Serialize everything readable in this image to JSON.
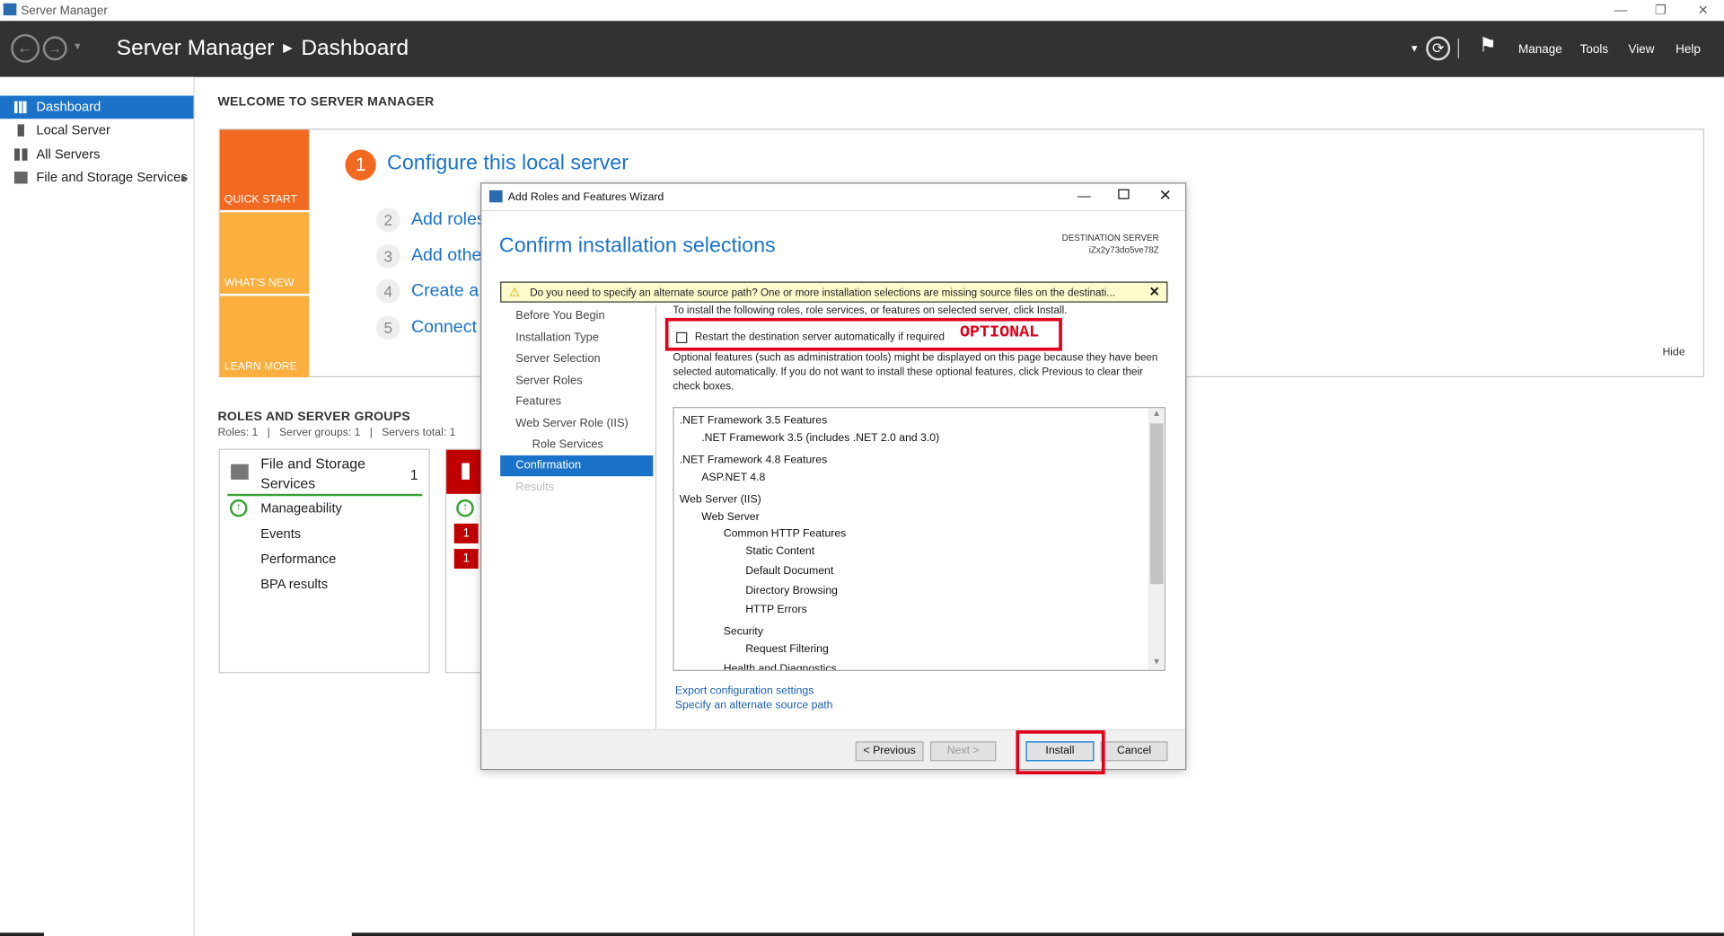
{
  "window": {
    "title": "Server Manager"
  },
  "header": {
    "app": "Server Manager",
    "page": "Dashboard",
    "menu": [
      "Manage",
      "Tools",
      "View",
      "Help"
    ]
  },
  "sidebar": {
    "items": [
      {
        "label": "Dashboard",
        "active": true
      },
      {
        "label": "Local Server"
      },
      {
        "label": "All Servers"
      },
      {
        "label": "File and Storage Services"
      }
    ]
  },
  "welcome": {
    "heading": "WELCOME TO SERVER MANAGER",
    "tiles": [
      "QUICK START",
      "WHAT'S NEW",
      "LEARN MORE"
    ],
    "steps": [
      {
        "n": "1",
        "label": "Configure this local server"
      },
      {
        "n": "2",
        "label": "Add roles"
      },
      {
        "n": "3",
        "label": "Add other"
      },
      {
        "n": "4",
        "label": "Create a s"
      },
      {
        "n": "5",
        "label": "Connect t"
      }
    ],
    "hide": "Hide"
  },
  "roles": {
    "heading": "ROLES AND SERVER GROUPS",
    "summary": "Roles: 1   |   Server groups: 1   |   Servers total: 1",
    "card": {
      "title_line1": "File and Storage",
      "title_line2": "Services",
      "count": "1",
      "rows": [
        "Manageability",
        "Events",
        "Performance",
        "BPA results"
      ]
    },
    "card2_badges": [
      "1",
      "1"
    ]
  },
  "wizard": {
    "title": "Add Roles and Features Wizard",
    "heading": "Confirm installation selections",
    "dest_label": "DESTINATION SERVER",
    "dest_value": "iZx2y73do5ve78Z",
    "warning": "Do you need to specify an alternate source path? One or more installation selections are missing source files on the destinati...",
    "nav": [
      "Before You Begin",
      "Installation Type",
      "Server Selection",
      "Server Roles",
      "Features",
      "Web Server Role (IIS)",
      "Role Services",
      "Confirmation",
      "Results"
    ],
    "intro": "To install the following roles, role services, or features on selected server, click Install.",
    "restart_label": "Restart the destination server automatically if required",
    "optional_note": "Optional features (such as administration tools) might be displayed on this page because they have been selected automatically. If you do not want to install these optional features, click Previous to clear their check boxes.",
    "features": [
      ".NET Framework 3.5 Features",
      ".NET Framework 3.5 (includes .NET 2.0 and 3.0)",
      ".NET Framework 4.8 Features",
      "ASP.NET 4.8",
      "Web Server (IIS)",
      "Web Server",
      "Common HTTP Features",
      "Static Content",
      "Default Document",
      "Directory Browsing",
      "HTTP Errors",
      "Security",
      "Request Filtering",
      "Health and Diagnostics"
    ],
    "links": [
      "Export configuration settings",
      "Specify an alternate source path"
    ],
    "buttons": {
      "previous": "< Previous",
      "next": "Next >",
      "install": "Install",
      "cancel": "Cancel"
    }
  },
  "annotation": {
    "optional": "OPTIONAL"
  }
}
